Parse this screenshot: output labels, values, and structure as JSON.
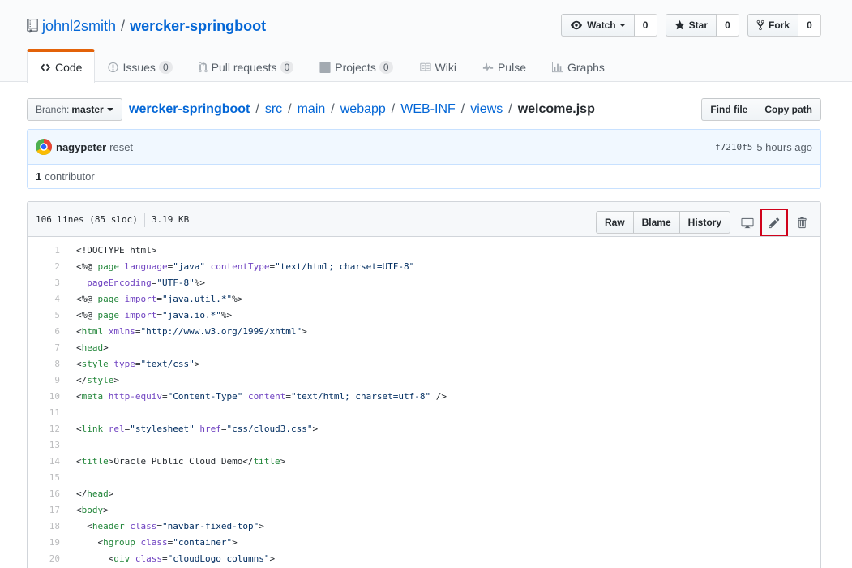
{
  "repo": {
    "owner": "johnl2smith",
    "separator": "/",
    "name": "wercker-springboot"
  },
  "actions": {
    "watch_label": "Watch",
    "watch_count": "0",
    "star_label": "Star",
    "star_count": "0",
    "fork_label": "Fork",
    "fork_count": "0"
  },
  "nav": {
    "code": "Code",
    "issues": "Issues",
    "issues_count": "0",
    "pulls": "Pull requests",
    "pulls_count": "0",
    "projects": "Projects",
    "projects_count": "0",
    "wiki": "Wiki",
    "pulse": "Pulse",
    "graphs": "Graphs"
  },
  "branch": {
    "label": "Branch:",
    "value": "master"
  },
  "breadcrumb": {
    "root": "wercker-springboot",
    "parts": [
      "src",
      "main",
      "webapp",
      "WEB-INF",
      "views"
    ],
    "separator": "/",
    "file": "welcome.jsp"
  },
  "path_actions": {
    "find_file": "Find file",
    "copy_path": "Copy path"
  },
  "commit": {
    "author": "nagypeter",
    "message": "reset",
    "sha": "f7210f5",
    "time": "5 hours ago",
    "contributors_count": "1",
    "contributors_label": "contributor"
  },
  "file": {
    "lines_info": "106 lines (85 sloc)",
    "size": "3.19 KB",
    "raw": "Raw",
    "blame": "Blame",
    "history": "History"
  },
  "icons": {
    "repo": "repo-icon",
    "eye": "eye-icon",
    "star": "star-icon",
    "fork": "fork-icon",
    "desktop": "desktop-icon",
    "pencil": "pencil-icon",
    "trash": "trash-icon"
  },
  "colors": {
    "link": "#0366d6",
    "tag": "#22863a",
    "attr": "#6f42c1",
    "string": "#032f62",
    "highlight_box": "#d0021b",
    "nav_selected": "#e36209"
  },
  "code_lines": [
    {
      "n": "1",
      "t": [
        [
          "p",
          "<!DOCTYPE html>"
        ]
      ]
    },
    {
      "n": "2",
      "t": [
        [
          "p",
          "<%@ "
        ],
        [
          "tag",
          "page"
        ],
        [
          "p",
          " "
        ],
        [
          "attr",
          "language"
        ],
        [
          "p",
          "="
        ],
        [
          "str",
          "\"java\""
        ],
        [
          "p",
          " "
        ],
        [
          "attr",
          "contentType"
        ],
        [
          "p",
          "="
        ],
        [
          "str",
          "\"text/html; charset=UTF-8\""
        ]
      ]
    },
    {
      "n": "3",
      "t": [
        [
          "p",
          "  "
        ],
        [
          "attr",
          "pageEncoding"
        ],
        [
          "p",
          "="
        ],
        [
          "str",
          "\"UTF-8\""
        ],
        [
          "p",
          "%>"
        ]
      ]
    },
    {
      "n": "4",
      "t": [
        [
          "p",
          "<%@ "
        ],
        [
          "tag",
          "page"
        ],
        [
          "p",
          " "
        ],
        [
          "attr",
          "import"
        ],
        [
          "p",
          "="
        ],
        [
          "str",
          "\"java.util.*\""
        ],
        [
          "p",
          "%>"
        ]
      ]
    },
    {
      "n": "5",
      "t": [
        [
          "p",
          "<%@ "
        ],
        [
          "tag",
          "page"
        ],
        [
          "p",
          " "
        ],
        [
          "attr",
          "import"
        ],
        [
          "p",
          "="
        ],
        [
          "str",
          "\"java.io.*\""
        ],
        [
          "p",
          "%>"
        ]
      ]
    },
    {
      "n": "6",
      "t": [
        [
          "p",
          "<"
        ],
        [
          "tag",
          "html"
        ],
        [
          "p",
          " "
        ],
        [
          "attr",
          "xmlns"
        ],
        [
          "p",
          "="
        ],
        [
          "str",
          "\"http://www.w3.org/1999/xhtml\""
        ],
        [
          "p",
          ">"
        ]
      ]
    },
    {
      "n": "7",
      "t": [
        [
          "p",
          "<"
        ],
        [
          "tag",
          "head"
        ],
        [
          "p",
          ">"
        ]
      ]
    },
    {
      "n": "8",
      "t": [
        [
          "p",
          "<"
        ],
        [
          "tag",
          "style"
        ],
        [
          "p",
          " "
        ],
        [
          "attr",
          "type"
        ],
        [
          "p",
          "="
        ],
        [
          "str",
          "\"text/css\""
        ],
        [
          "p",
          ">"
        ]
      ]
    },
    {
      "n": "9",
      "t": [
        [
          "p",
          "</"
        ],
        [
          "tag",
          "style"
        ],
        [
          "p",
          ">"
        ]
      ]
    },
    {
      "n": "10",
      "t": [
        [
          "p",
          "<"
        ],
        [
          "tag",
          "meta"
        ],
        [
          "p",
          " "
        ],
        [
          "attr",
          "http-equiv"
        ],
        [
          "p",
          "="
        ],
        [
          "str",
          "\"Content-Type\""
        ],
        [
          "p",
          " "
        ],
        [
          "attr",
          "content"
        ],
        [
          "p",
          "="
        ],
        [
          "str",
          "\"text/html; charset=utf-8\""
        ],
        [
          "p",
          " />"
        ]
      ]
    },
    {
      "n": "11",
      "t": []
    },
    {
      "n": "12",
      "t": [
        [
          "p",
          "<"
        ],
        [
          "tag",
          "link"
        ],
        [
          "p",
          " "
        ],
        [
          "attr",
          "rel"
        ],
        [
          "p",
          "="
        ],
        [
          "str",
          "\"stylesheet\""
        ],
        [
          "p",
          " "
        ],
        [
          "attr",
          "href"
        ],
        [
          "p",
          "="
        ],
        [
          "str",
          "\"css/cloud3.css\""
        ],
        [
          "p",
          ">"
        ]
      ]
    },
    {
      "n": "13",
      "t": []
    },
    {
      "n": "14",
      "t": [
        [
          "p",
          "<"
        ],
        [
          "tag",
          "title"
        ],
        [
          "p",
          ">Oracle Public Cloud Demo</"
        ],
        [
          "tag",
          "title"
        ],
        [
          "p",
          ">"
        ]
      ]
    },
    {
      "n": "15",
      "t": []
    },
    {
      "n": "16",
      "t": [
        [
          "p",
          "</"
        ],
        [
          "tag",
          "head"
        ],
        [
          "p",
          ">"
        ]
      ]
    },
    {
      "n": "17",
      "t": [
        [
          "p",
          "<"
        ],
        [
          "tag",
          "body"
        ],
        [
          "p",
          ">"
        ]
      ]
    },
    {
      "n": "18",
      "t": [
        [
          "p",
          "  <"
        ],
        [
          "tag",
          "header"
        ],
        [
          "p",
          " "
        ],
        [
          "attr",
          "class"
        ],
        [
          "p",
          "="
        ],
        [
          "str",
          "\"navbar-fixed-top\""
        ],
        [
          "p",
          ">"
        ]
      ]
    },
    {
      "n": "19",
      "t": [
        [
          "p",
          "    <"
        ],
        [
          "tag",
          "hgroup"
        ],
        [
          "p",
          " "
        ],
        [
          "attr",
          "class"
        ],
        [
          "p",
          "="
        ],
        [
          "str",
          "\"container\""
        ],
        [
          "p",
          ">"
        ]
      ]
    },
    {
      "n": "20",
      "t": [
        [
          "p",
          "      <"
        ],
        [
          "tag",
          "div"
        ],
        [
          "p",
          " "
        ],
        [
          "attr",
          "class"
        ],
        [
          "p",
          "="
        ],
        [
          "str",
          "\"cloudLogo columns\""
        ],
        [
          "p",
          ">"
        ]
      ]
    }
  ]
}
